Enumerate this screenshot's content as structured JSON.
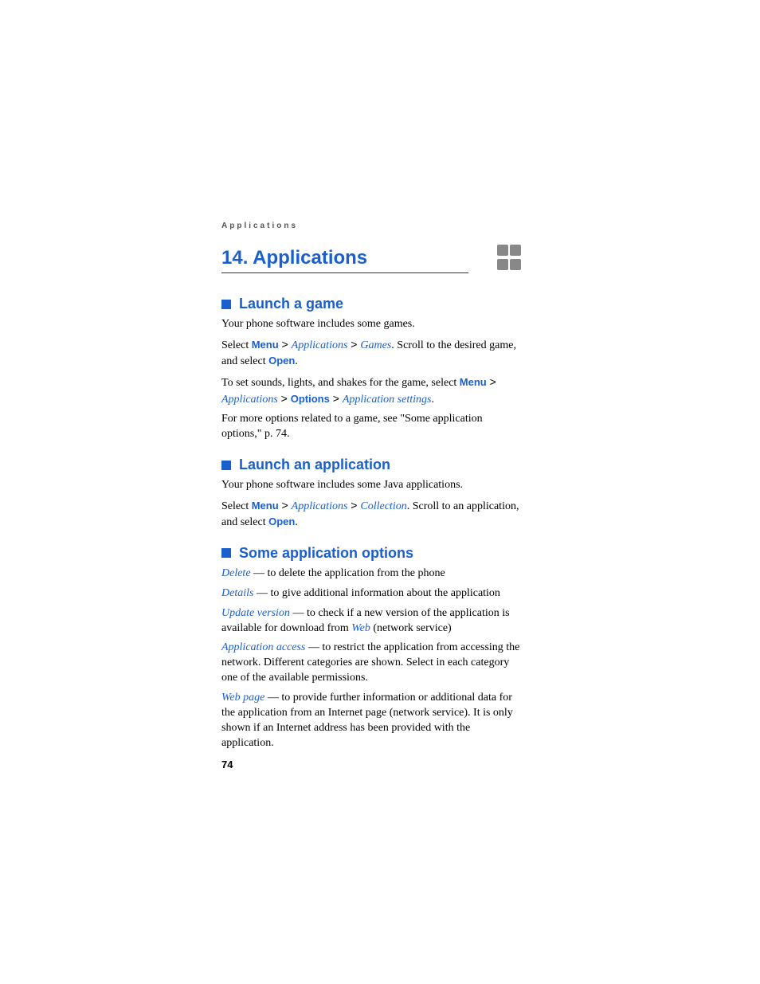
{
  "runningHead": "Applications",
  "chapterTitle": "14. Applications",
  "pageNumber": "74",
  "sec1": {
    "heading": "Launch a game",
    "p1": "Your phone software includes some games.",
    "p2_a": "Select ",
    "menu": "Menu",
    "applications": "Applications",
    "games": "Games",
    "p2_b": ". Scroll to the desired game, and select ",
    "open": "Open",
    "p3_a": "To set sounds, lights, and shakes for the game, select ",
    "options": "Options",
    "appsettings": "Application settings",
    "p4": "For more options related to a game, see \"Some application options,\" p. 74."
  },
  "sec2": {
    "heading": "Launch an application",
    "p1": "Your phone software includes some Java applications.",
    "p2_a": "Select ",
    "menu": "Menu",
    "applications": "Applications",
    "collection": "Collection",
    "p2_b": ". Scroll to an application, and select ",
    "open": "Open"
  },
  "sec3": {
    "heading": "Some application options",
    "delete": "Delete",
    "delete_t": " — to delete the application from the phone",
    "details": "Details",
    "details_t": " — to give additional information about the application",
    "update": "Update version",
    "update_t1": " — to check if a new version of the application is available for download from ",
    "web": "Web",
    "update_t2": " (network service)",
    "access": "Application access",
    "access_t": " — to restrict the application from accessing the network. Different categories are shown. Select in each category one of the available permissions.",
    "webpage": "Web page",
    "webpage_t": " — to provide further information or additional data for the application from an Internet page (network service). It is only shown if an Internet address has been provided with the application."
  }
}
